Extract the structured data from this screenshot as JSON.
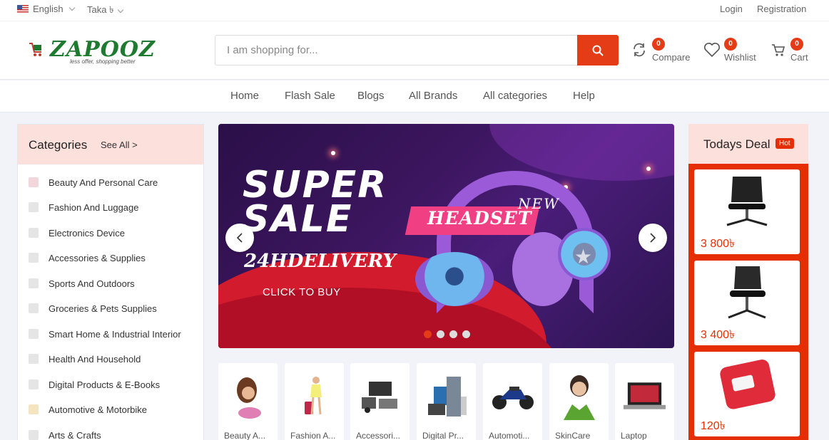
{
  "topbar": {
    "language": "English",
    "currency": "Taka ৳",
    "login": "Login",
    "registration": "Registration"
  },
  "header": {
    "logo_text": "ZAPOOZ",
    "logo_tagline": "less offer, shopping better",
    "search_placeholder": "I am shopping for...",
    "compare": {
      "label": "Compare",
      "count": "0"
    },
    "wishlist": {
      "label": "Wishlist",
      "count": "0"
    },
    "cart": {
      "label": "Cart",
      "count": "0"
    }
  },
  "nav": [
    "Home",
    "Flash Sale",
    "Blogs",
    "All Brands",
    "All categories",
    "Help"
  ],
  "categories": {
    "title": "Categories",
    "see_all": "See All >",
    "items": [
      "Beauty And Personal Care",
      "Fashion And Luggage",
      "Electronics Device",
      "Accessories & Supplies",
      "Sports And Outdoors",
      "Groceries & Pets Supplies",
      "Smart Home & Industrial Interior",
      "Health And Household",
      "Digital Products & E-Books",
      "Automotive & Motorbike",
      "Arts & Crafts"
    ]
  },
  "banner": {
    "line1": "SUPER",
    "line2": "SALE",
    "delivery": "24HDELIVERY",
    "cta": "CLICK TO BUY",
    "headset": "HEADSET",
    "new": "NEW",
    "slides": 4,
    "active_slide": 1
  },
  "category_tiles": [
    "Beauty A...",
    "Fashion A...",
    "Accessori...",
    "Digital Pr...",
    "Automoti...",
    "SkinCare",
    "Laptop"
  ],
  "deals": {
    "title": "Todays Deal",
    "badge": "Hot",
    "items": [
      {
        "price": "3 800৳"
      },
      {
        "price": "3 400৳"
      },
      {
        "price": "120৳"
      }
    ]
  },
  "colors": {
    "accent": "#e43c16",
    "brand_green": "#1e7a2e",
    "deal_bg": "#e62e04",
    "header_pink": "#fbe0dc"
  }
}
